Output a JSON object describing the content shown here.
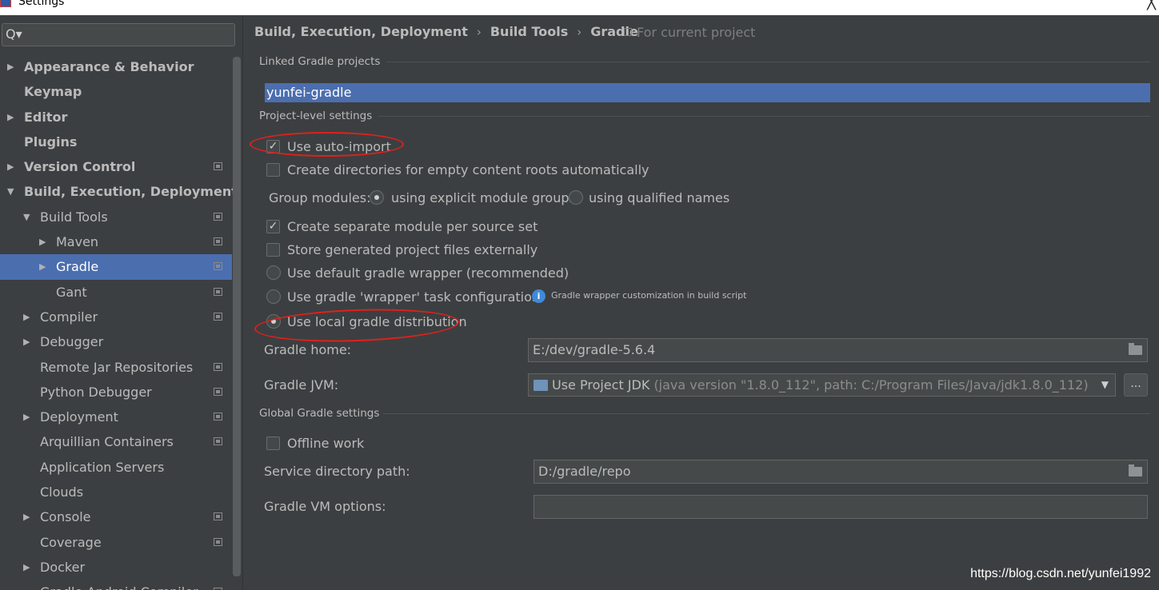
{
  "window": {
    "title": "Settings",
    "close_label": "╳"
  },
  "search": {
    "icon": "Q▾",
    "placeholder": ""
  },
  "sidebar": {
    "items": [
      {
        "label": "Appearance & Behavior",
        "arrow": "▶",
        "level": 0,
        "bold": true
      },
      {
        "label": "Keymap",
        "arrow": "",
        "level": 0,
        "bold": true
      },
      {
        "label": "Editor",
        "arrow": "▶",
        "level": 0,
        "bold": true
      },
      {
        "label": "Plugins",
        "arrow": "",
        "level": 0,
        "bold": true
      },
      {
        "label": "Version Control",
        "arrow": "▶",
        "level": 0,
        "bold": true,
        "project": true
      },
      {
        "label": "Build, Execution, Deployment",
        "arrow": "▼",
        "level": 0,
        "bold": true
      },
      {
        "label": "Build Tools",
        "arrow": "▼",
        "level": 1,
        "project": true
      },
      {
        "label": "Maven",
        "arrow": "▶",
        "level": 2,
        "project": true
      },
      {
        "label": "Gradle",
        "arrow": "▶",
        "level": 2,
        "project": true,
        "selected": true
      },
      {
        "label": "Gant",
        "arrow": "",
        "level": 2,
        "project": true
      },
      {
        "label": "Compiler",
        "arrow": "▶",
        "level": 1,
        "project": true
      },
      {
        "label": "Debugger",
        "arrow": "▶",
        "level": 1
      },
      {
        "label": "Remote Jar Repositories",
        "arrow": "",
        "level": 1,
        "project": true
      },
      {
        "label": "Python Debugger",
        "arrow": "",
        "level": 1,
        "project": true
      },
      {
        "label": "Deployment",
        "arrow": "▶",
        "level": 1,
        "project": true
      },
      {
        "label": "Arquillian Containers",
        "arrow": "",
        "level": 1,
        "project": true
      },
      {
        "label": "Application Servers",
        "arrow": "",
        "level": 1
      },
      {
        "label": "Clouds",
        "arrow": "",
        "level": 1
      },
      {
        "label": "Console",
        "arrow": "▶",
        "level": 1,
        "project": true
      },
      {
        "label": "Coverage",
        "arrow": "",
        "level": 1,
        "project": true
      },
      {
        "label": "Docker",
        "arrow": "▶",
        "level": 1
      },
      {
        "label": "Gradle-Android Compiler",
        "arrow": "",
        "level": 1,
        "project": true
      }
    ]
  },
  "breadcrumb": {
    "items": [
      "Build, Execution, Deployment",
      "Build Tools",
      "Gradle"
    ],
    "separator": "›",
    "scope": "For current project"
  },
  "linked": {
    "title": "Linked Gradle projects",
    "projects": [
      "yunfei-gradle"
    ]
  },
  "project_settings": {
    "title": "Project-level settings",
    "auto_import": {
      "label": "Use auto-import",
      "checked": true
    },
    "create_dirs": {
      "label": "Create directories for empty content roots automatically",
      "checked": false
    },
    "group_modules": {
      "label": "Group modules:",
      "option_explicit": "using explicit module groups",
      "option_qualified": "using qualified names",
      "selected": "explicit"
    },
    "separate_module": {
      "label": "Create separate module per source set",
      "checked": true
    },
    "store_external": {
      "label": "Store generated project files externally",
      "checked": false
    },
    "wrapper_default": {
      "label": "Use default gradle wrapper (recommended)",
      "selected": false
    },
    "wrapper_task": {
      "label": "Use gradle 'wrapper' task configuration",
      "selected": false
    },
    "wrapper_info": {
      "icon": "i",
      "text": "Gradle wrapper customization in build script"
    },
    "local_distribution": {
      "label": "Use local gradle distribution",
      "selected": true
    },
    "gradle_home": {
      "label": "Gradle home:",
      "value": "E:/dev/gradle-5.6.4"
    },
    "gradle_jvm": {
      "label": "Gradle JVM:",
      "value": "Use Project JDK",
      "detail": "(java version \"1.8.0_112\", path: C:/Program Files/Java/jdk1.8.0_112)",
      "arrow": "▼",
      "more_label": "..."
    }
  },
  "global_settings": {
    "title": "Global Gradle settings",
    "offline": {
      "label": "Offline work",
      "checked": false
    },
    "service_dir": {
      "label": "Service directory path:",
      "value": "D:/gradle/repo"
    },
    "vm_options": {
      "label": "Gradle VM options:",
      "value": ""
    }
  },
  "watermark": "https://blog.csdn.net/yunfei1992",
  "colors": {
    "selection": "#4b6eaf",
    "annotation": "#e0201c",
    "background": "#3c3f41"
  }
}
